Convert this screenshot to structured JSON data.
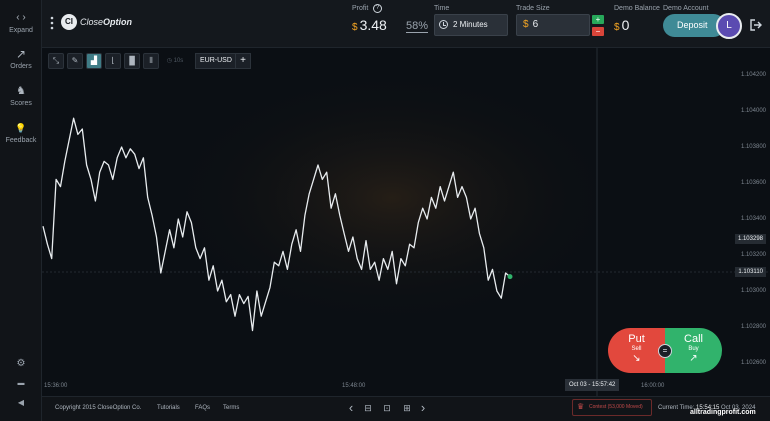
{
  "sidebar": {
    "items": [
      {
        "label": "Expand",
        "icon": "expand-icon",
        "glyph": "‹ ›"
      },
      {
        "label": "Orders",
        "icon": "orders-chart-icon",
        "glyph": "↗"
      },
      {
        "label": "Scores",
        "icon": "scores-icon",
        "glyph": "♞"
      },
      {
        "label": "Feedback",
        "icon": "feedback-bulb-icon",
        "glyph": "💡"
      }
    ],
    "bottom": [
      {
        "icon": "settings-icon",
        "glyph": "⚙"
      },
      {
        "icon": "chat-icon",
        "glyph": "▬"
      },
      {
        "icon": "sound-icon",
        "glyph": "◀"
      }
    ]
  },
  "header": {
    "logo_mark": "CI",
    "logo_text_a": "Close",
    "logo_text_b": "Option",
    "profit_label": "Profit",
    "profit_currency": "$",
    "profit_value": "3.48",
    "profit_pct": "58%",
    "time_label": "Time",
    "time_value": "2 Minutes",
    "trade_label": "Trade Size",
    "trade_currency": "$",
    "trade_value": "6",
    "plus": "+",
    "minus": "−",
    "balance_label": "Demo Balance",
    "balance_currency": "$",
    "balance_value": "0",
    "account_label": "Demo Account",
    "deposit_label": "Deposit",
    "avatar_letter": "L"
  },
  "toolbar": {
    "tools": [
      {
        "icon": "fullscreen-icon",
        "glyph": "⤡",
        "active": false
      },
      {
        "icon": "draw-pencil-icon",
        "glyph": "✎",
        "active": false
      },
      {
        "icon": "area-chart-icon",
        "glyph": "▟",
        "active": true
      },
      {
        "icon": "line-chart-icon",
        "glyph": "⌊",
        "active": false
      },
      {
        "icon": "bar-chart-icon",
        "glyph": "▐▌",
        "active": false
      },
      {
        "icon": "candle-chart-icon",
        "glyph": "⫴",
        "active": false
      }
    ],
    "timeframe": "10s",
    "asset": "EUR-USD",
    "add": "+"
  },
  "chart_data": {
    "type": "line",
    "asset": "EUR-USD",
    "yticks": [
      "1.104200",
      "1.104000",
      "1.103800",
      "1.103600",
      "1.103400",
      "1.103200",
      "1.103000",
      "1.102800",
      "1.102600"
    ],
    "ylim": [
      1.1025,
      1.1043
    ],
    "current_price": "1.103110",
    "marker_price": "1.103298",
    "xticks": [
      "15:36:00",
      "15:48:00",
      "16:00:00"
    ],
    "cursor_time": "Oct 03 - 15:57:42",
    "series": [
      {
        "values": [
          1.10336,
          1.10326,
          1.10318,
          1.10362,
          1.10358,
          1.10372,
          1.10384,
          1.10396,
          1.10387,
          1.1039,
          1.1037,
          1.10362,
          1.1035,
          1.10366,
          1.10372,
          1.1037,
          1.10362,
          1.10374,
          1.1038,
          1.10374,
          1.10379,
          1.10376,
          1.10368,
          1.10374,
          1.10352,
          1.10342,
          1.1033,
          1.1031,
          1.10322,
          1.10334,
          1.10324,
          1.1034,
          1.1033,
          1.10344,
          1.10338,
          1.10324,
          1.10318,
          1.10324,
          1.10306,
          1.10314,
          1.103,
          1.10306,
          1.10294,
          1.10298,
          1.10286,
          1.10298,
          1.10293,
          1.10297,
          1.10278,
          1.103,
          1.10286,
          1.10294,
          1.10302,
          1.10316,
          1.10314,
          1.10322,
          1.10312,
          1.10326,
          1.10334,
          1.10322,
          1.10342,
          1.10354,
          1.10362,
          1.1037,
          1.10362,
          1.10366,
          1.10346,
          1.10354,
          1.10342,
          1.10332,
          1.10322,
          1.1033,
          1.10318,
          1.10312,
          1.10328,
          1.10312,
          1.10316,
          1.10306,
          1.10318,
          1.10312,
          1.10322,
          1.10304,
          1.10318,
          1.10314,
          1.10326,
          1.10324,
          1.10338,
          1.10346,
          1.1034,
          1.10352,
          1.10346,
          1.10358,
          1.1035,
          1.10358,
          1.10366,
          1.10352,
          1.10358,
          1.10352,
          1.1034,
          1.10346,
          1.10332,
          1.10324,
          1.10306,
          1.10312,
          1.103,
          1.10296,
          1.1031,
          1.10308
        ]
      }
    ],
    "colors": {
      "line": "#e8ecef",
      "put": "#e2483d",
      "call": "#31b36c",
      "accent": "#3f8a96"
    }
  },
  "trade_widget": {
    "put_label": "Put",
    "put_sub": "Sell",
    "put_arrow": "↘",
    "call_label": "Call",
    "call_sub": "Buy",
    "call_arrow": "↗",
    "eq": "="
  },
  "footer": {
    "copyright": "Copyright 2015 CloseOption Co.",
    "links": [
      "Tutorials",
      "FAQs",
      "Terms"
    ],
    "nav": [
      {
        "icon": "chevron-left-icon",
        "glyph": "‹"
      },
      {
        "icon": "zoom-out-icon",
        "glyph": "⊟"
      },
      {
        "icon": "fit-screen-icon",
        "glyph": "⊡"
      },
      {
        "icon": "zoom-in-icon",
        "glyph": "⊞"
      },
      {
        "icon": "chevron-right-icon",
        "glyph": "›"
      }
    ],
    "contest": "Contest (53,000 Moved)",
    "current_time_label": "Current Time:",
    "current_time": "15:54:15",
    "current_date": "Oct 03, 2024",
    "watermark": "alltradingprofit.com"
  }
}
